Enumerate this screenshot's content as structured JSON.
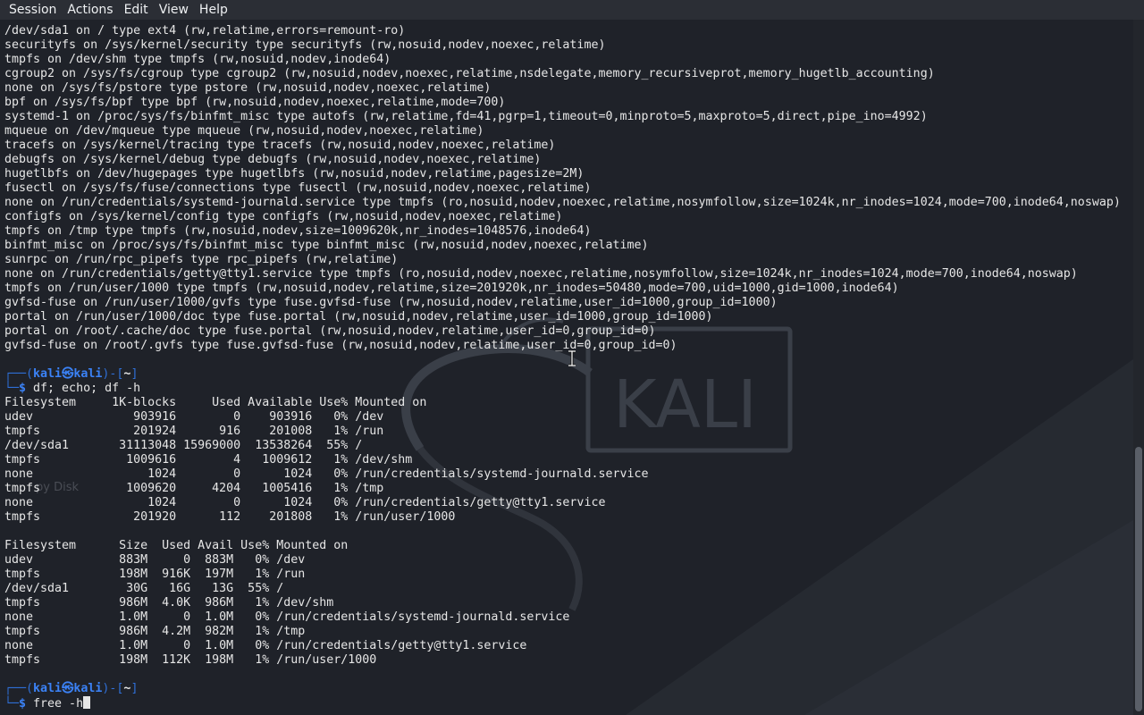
{
  "menubar": {
    "items": [
      "Session",
      "Actions",
      "Edit",
      "View",
      "Help"
    ]
  },
  "wallpaper": {
    "logo_text": "KALI",
    "desktop_icon_label": "py Disk"
  },
  "prompt": {
    "user": "kali",
    "at": "㉿",
    "host": "kali",
    "dir": "~"
  },
  "lines_top": [
    "/dev/sda1 on / type ext4 (rw,relatime,errors=remount-ro)",
    "securityfs on /sys/kernel/security type securityfs (rw,nosuid,nodev,noexec,relatime)",
    "tmpfs on /dev/shm type tmpfs (rw,nosuid,nodev,inode64)",
    "cgroup2 on /sys/fs/cgroup type cgroup2 (rw,nosuid,nodev,noexec,relatime,nsdelegate,memory_recursiveprot,memory_hugetlb_accounting)",
    "none on /sys/fs/pstore type pstore (rw,nosuid,nodev,noexec,relatime)",
    "bpf on /sys/fs/bpf type bpf (rw,nosuid,nodev,noexec,relatime,mode=700)",
    "systemd-1 on /proc/sys/fs/binfmt_misc type autofs (rw,relatime,fd=41,pgrp=1,timeout=0,minproto=5,maxproto=5,direct,pipe_ino=4992)",
    "mqueue on /dev/mqueue type mqueue (rw,nosuid,nodev,noexec,relatime)",
    "tracefs on /sys/kernel/tracing type tracefs (rw,nosuid,nodev,noexec,relatime)",
    "debugfs on /sys/kernel/debug type debugfs (rw,nosuid,nodev,noexec,relatime)",
    "hugetlbfs on /dev/hugepages type hugetlbfs (rw,nosuid,nodev,relatime,pagesize=2M)",
    "fusectl on /sys/fs/fuse/connections type fusectl (rw,nosuid,nodev,noexec,relatime)",
    "none on /run/credentials/systemd-journald.service type tmpfs (ro,nosuid,nodev,noexec,relatime,nosymfollow,size=1024k,nr_inodes=1024,mode=700,inode64,noswap)",
    "configfs on /sys/kernel/config type configfs (rw,nosuid,nodev,noexec,relatime)",
    "tmpfs on /tmp type tmpfs (rw,nosuid,nodev,size=1009620k,nr_inodes=1048576,inode64)",
    "binfmt_misc on /proc/sys/fs/binfmt_misc type binfmt_misc (rw,nosuid,nodev,noexec,relatime)",
    "sunrpc on /run/rpc_pipefs type rpc_pipefs (rw,relatime)",
    "none on /run/credentials/getty@tty1.service type tmpfs (ro,nosuid,nodev,noexec,relatime,nosymfollow,size=1024k,nr_inodes=1024,mode=700,inode64,noswap)",
    "tmpfs on /run/user/1000 type tmpfs (rw,nosuid,nodev,relatime,size=201920k,nr_inodes=50480,mode=700,uid=1000,gid=1000,inode64)",
    "gvfsd-fuse on /run/user/1000/gvfs type fuse.gvfsd-fuse (rw,nosuid,nodev,relatime,user_id=1000,group_id=1000)",
    "portal on /run/user/1000/doc type fuse.portal (rw,nosuid,nodev,relatime,user_id=1000,group_id=1000)",
    "portal on /root/.cache/doc type fuse.portal (rw,nosuid,nodev,relatime,user_id=0,group_id=0)",
    "gvfsd-fuse on /root/.gvfs type fuse.gvfsd-fuse (rw,nosuid,nodev,relatime,user_id=0,group_id=0)",
    ""
  ],
  "command_1": "df; echo; df -h",
  "lines_df": [
    "Filesystem     1K-blocks     Used Available Use% Mounted on",
    "udev              903916        0    903916   0% /dev",
    "tmpfs             201924      916    201008   1% /run",
    "/dev/sda1       31113048 15969000  13538264  55% /",
    "tmpfs            1009616        4   1009612   1% /dev/shm",
    "none                1024        0      1024   0% /run/credentials/systemd-journald.service",
    "tmpfs            1009620     4204   1005416   1% /tmp",
    "none                1024        0      1024   0% /run/credentials/getty@tty1.service",
    "tmpfs             201920      112    201808   1% /run/user/1000",
    "",
    "Filesystem      Size  Used Avail Use% Mounted on",
    "udev            883M     0  883M   0% /dev",
    "tmpfs           198M  916K  197M   1% /run",
    "/dev/sda1        30G   16G   13G  55% /",
    "tmpfs           986M  4.0K  986M   1% /dev/shm",
    "none            1.0M     0  1.0M   0% /run/credentials/systemd-journald.service",
    "tmpfs           986M  4.2M  982M   1% /tmp",
    "none            1.0M     0  1.0M   0% /run/credentials/getty@tty1.service",
    "tmpfs           198M  112K  198M   1% /run/user/1000",
    ""
  ],
  "command_2": "free -h",
  "colors": {
    "background": "#1f2229",
    "menubar": "#2b2e35",
    "prompt_blue": "#3b82f6",
    "text": "#e6e6e6"
  }
}
